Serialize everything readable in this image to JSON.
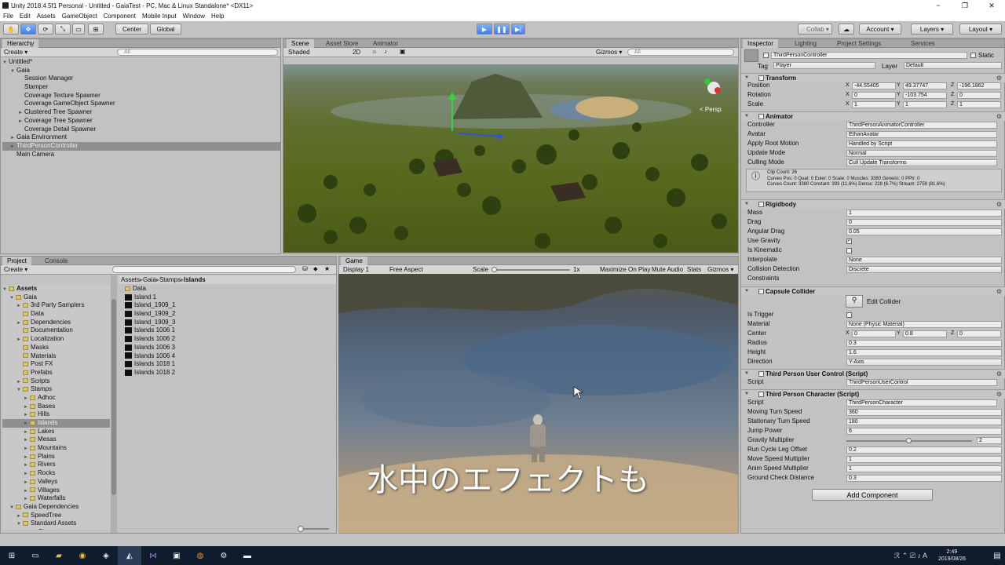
{
  "window": {
    "title": "Unity 2018.4.5f1 Personal - Untitled - GaiaTest - PC, Mac & Linux Standalone* <DX11>",
    "minimize": "−",
    "maximize": "❐",
    "close": "✕"
  },
  "menu": [
    "File",
    "Edit",
    "Assets",
    "GameObject",
    "Component",
    "Mobile Input",
    "Window",
    "Help"
  ],
  "toolbar": {
    "pivot": "Center",
    "space": "Global",
    "collab": "◌ Collab ▾",
    "cloud": "☁",
    "account": "Account ▾",
    "layers": "Layers ▾",
    "layout": "Layout ▾",
    "play": "▶",
    "pause": "❚❚",
    "step": "▶|"
  },
  "hierarchy": {
    "tab": "Hierarchy",
    "create": "Create ▾",
    "search": "All",
    "scene": "Untitled*",
    "items": [
      {
        "label": "Gaia",
        "indent": 1,
        "arrow": "▼"
      },
      {
        "label": "Session Manager",
        "indent": 2,
        "arrow": ""
      },
      {
        "label": "Stamper",
        "indent": 2,
        "arrow": ""
      },
      {
        "label": "Coverage Texture Spawner",
        "indent": 2,
        "arrow": ""
      },
      {
        "label": "Coverage GameObject Spawner",
        "indent": 2,
        "arrow": ""
      },
      {
        "label": "Clustered Tree Spawner",
        "indent": 2,
        "arrow": "►"
      },
      {
        "label": "Coverage Tree Spawner",
        "indent": 2,
        "arrow": "►"
      },
      {
        "label": "Coverage Detail Spawner",
        "indent": 2,
        "arrow": ""
      },
      {
        "label": "Gaia Environment",
        "indent": 1,
        "arrow": "►"
      },
      {
        "label": "ThirdPersonController",
        "indent": 1,
        "arrow": "►",
        "selected": true
      },
      {
        "label": "Main Camera",
        "indent": 1,
        "arrow": ""
      }
    ]
  },
  "scene": {
    "tabs": [
      "Scene",
      "Asset Store",
      "Animator"
    ],
    "shading": "Shaded",
    "mode2d": "2D",
    "gizmos": "Gizmos ▾",
    "search": "All",
    "persp": "< Persp"
  },
  "project": {
    "tabs": [
      "Project",
      "Console"
    ],
    "create": "Create ▾",
    "breadcrumb": [
      "Assets",
      "Gaia",
      "Stamps",
      "Islands"
    ],
    "tree": [
      {
        "label": "Assets",
        "indent": 0,
        "arrow": "▼",
        "bold": true
      },
      {
        "label": "Gaia",
        "indent": 1,
        "arrow": "▼"
      },
      {
        "label": "3rd Party Samplers",
        "indent": 2,
        "arrow": "►"
      },
      {
        "label": "Data",
        "indent": 2,
        "arrow": ""
      },
      {
        "label": "Dependencies",
        "indent": 2,
        "arrow": "►"
      },
      {
        "label": "Documentation",
        "indent": 2,
        "arrow": ""
      },
      {
        "label": "Localization",
        "indent": 2,
        "arrow": "►"
      },
      {
        "label": "Masks",
        "indent": 2,
        "arrow": ""
      },
      {
        "label": "Materials",
        "indent": 2,
        "arrow": ""
      },
      {
        "label": "Post FX",
        "indent": 2,
        "arrow": ""
      },
      {
        "label": "Prefabs",
        "indent": 2,
        "arrow": ""
      },
      {
        "label": "Scripts",
        "indent": 2,
        "arrow": "►"
      },
      {
        "label": "Stamps",
        "indent": 2,
        "arrow": "▼"
      },
      {
        "label": "Adhoc",
        "indent": 3,
        "arrow": "►"
      },
      {
        "label": "Bases",
        "indent": 3,
        "arrow": "►"
      },
      {
        "label": "Hills",
        "indent": 3,
        "arrow": "►"
      },
      {
        "label": "Islands",
        "indent": 3,
        "arrow": "►",
        "selected": true
      },
      {
        "label": "Lakes",
        "indent": 3,
        "arrow": "►"
      },
      {
        "label": "Mesas",
        "indent": 3,
        "arrow": "►"
      },
      {
        "label": "Mountains",
        "indent": 3,
        "arrow": "►"
      },
      {
        "label": "Plains",
        "indent": 3,
        "arrow": "►"
      },
      {
        "label": "Rivers",
        "indent": 3,
        "arrow": "►"
      },
      {
        "label": "Rocks",
        "indent": 3,
        "arrow": "►"
      },
      {
        "label": "Valleys",
        "indent": 3,
        "arrow": "►"
      },
      {
        "label": "Villages",
        "indent": 3,
        "arrow": "►"
      },
      {
        "label": "Waterfalls",
        "indent": 3,
        "arrow": "►"
      },
      {
        "label": "Gaia Dependencies",
        "indent": 1,
        "arrow": "▼"
      },
      {
        "label": "SpeedTree",
        "indent": 2,
        "arrow": "►"
      },
      {
        "label": "Standard Assets",
        "indent": 2,
        "arrow": "▼"
      },
      {
        "label": "Characters",
        "indent": 3,
        "arrow": "►"
      }
    ],
    "files": [
      {
        "label": "Data",
        "kind": "folder"
      },
      {
        "label": "Island 1",
        "kind": "tex"
      },
      {
        "label": "Island_1909_1",
        "kind": "tex"
      },
      {
        "label": "Island_1909_2",
        "kind": "tex"
      },
      {
        "label": "Island_1909_3",
        "kind": "tex"
      },
      {
        "label": "Islands 1006 1",
        "kind": "tex"
      },
      {
        "label": "Islands 1006 2",
        "kind": "tex"
      },
      {
        "label": "Islands 1006 3",
        "kind": "tex"
      },
      {
        "label": "Islands 1006 4",
        "kind": "tex"
      },
      {
        "label": "Islands 1018 1",
        "kind": "tex"
      },
      {
        "label": "Islands 1018 2",
        "kind": "tex"
      }
    ]
  },
  "game": {
    "tab": "Game",
    "display": "Display 1",
    "aspect": "Free Aspect",
    "scale_label": "Scale",
    "scale_value": "1x",
    "maximize": "Maximize On Play",
    "mute": "Mute Audio",
    "stats": "Stats",
    "gizmos": "Gizmos ▾",
    "subtitle": "水中のエフェクトも"
  },
  "inspector": {
    "tabs": [
      "Inspector",
      "Lighting",
      "Project Settings",
      "Services"
    ],
    "name": "ThirdPersonController",
    "static": "Static",
    "tag_label": "Tag",
    "tag": "Player",
    "layer_label": "Layer",
    "layer": "Default",
    "transform": {
      "title": "Transform",
      "rows": [
        {
          "label": "Position",
          "x": "-44.55405",
          "y": "49.37747",
          "z": "-196.1862"
        },
        {
          "label": "Rotation",
          "x": "0",
          "y": "-103.754",
          "z": "0"
        },
        {
          "label": "Scale",
          "x": "1",
          "y": "1",
          "z": "1"
        }
      ]
    },
    "animator": {
      "title": "Animator",
      "rows": [
        {
          "label": "Controller",
          "value": "ThirdPersonAnimatorController"
        },
        {
          "label": "Avatar",
          "value": "EthanAvatar"
        },
        {
          "label": "Apply Root Motion",
          "value": "Handled by Script"
        },
        {
          "label": "Update Mode",
          "value": "Normal"
        },
        {
          "label": "Culling Mode",
          "value": "Cull Update Transforms"
        }
      ],
      "info": [
        "Clip Count: 26",
        "Curves Pos: 0 Quat: 0 Euler: 0 Scale: 0 Muscles: 3380 Generic: 0 PPtr: 0",
        "Curves Count: 3380 Constant: 393 (11.6%) Dense: 228 (6.7%) Stream: 2759 (81.6%)"
      ]
    },
    "rigidbody": {
      "title": "Rigidbody",
      "rows": [
        {
          "label": "Mass",
          "value": "1"
        },
        {
          "label": "Drag",
          "value": "0"
        },
        {
          "label": "Angular Drag",
          "value": "0.05"
        },
        {
          "label": "Use Gravity",
          "value": "✓"
        },
        {
          "label": "Is Kinematic",
          "value": ""
        },
        {
          "label": "Interpolate",
          "value": "None"
        },
        {
          "label": "Collision Detection",
          "value": "Discrete"
        },
        {
          "label": "Constraints",
          "value": ""
        }
      ]
    },
    "capsule": {
      "title": "Capsule Collider",
      "edit": "Edit Collider",
      "rows": [
        {
          "label": "Is Trigger",
          "value": ""
        },
        {
          "label": "Material",
          "value": "None (Physic Material)"
        },
        {
          "label": "Radius",
          "value": "0.3"
        },
        {
          "label": "Height",
          "value": "1.6"
        },
        {
          "label": "Direction",
          "value": "Y-Axis"
        }
      ],
      "center_label": "Center",
      "center": {
        "x": "0",
        "y": "0.8",
        "z": "0"
      }
    },
    "user_control": {
      "title": "Third Person User Control (Script)",
      "script_label": "Script",
      "script": "ThirdPersonUserControl"
    },
    "character": {
      "title": "Third Person Character (Script)",
      "script_label": "Script",
      "script": "ThirdPersonCharacter",
      "rows": [
        {
          "label": "Moving Turn Speed",
          "value": "360"
        },
        {
          "label": "Stationary Turn Speed",
          "value": "180"
        },
        {
          "label": "Jump Power",
          "value": "6"
        },
        {
          "label": "Gravity Multiplier",
          "value": "2"
        },
        {
          "label": "Run Cycle Leg Offset",
          "value": "0.2"
        },
        {
          "label": "Move Speed Multiplier",
          "value": "1"
        },
        {
          "label": "Anim Speed Multiplier",
          "value": "1"
        },
        {
          "label": "Ground Check Distance",
          "value": "0.3"
        }
      ]
    },
    "gravity_slider_fraction": 0.5,
    "add_component": "Add Component"
  },
  "taskbar": {
    "time": "2:49",
    "date": "2019/08/26",
    "tray": "ℛ ⌃ ⎚ ♪ A"
  }
}
